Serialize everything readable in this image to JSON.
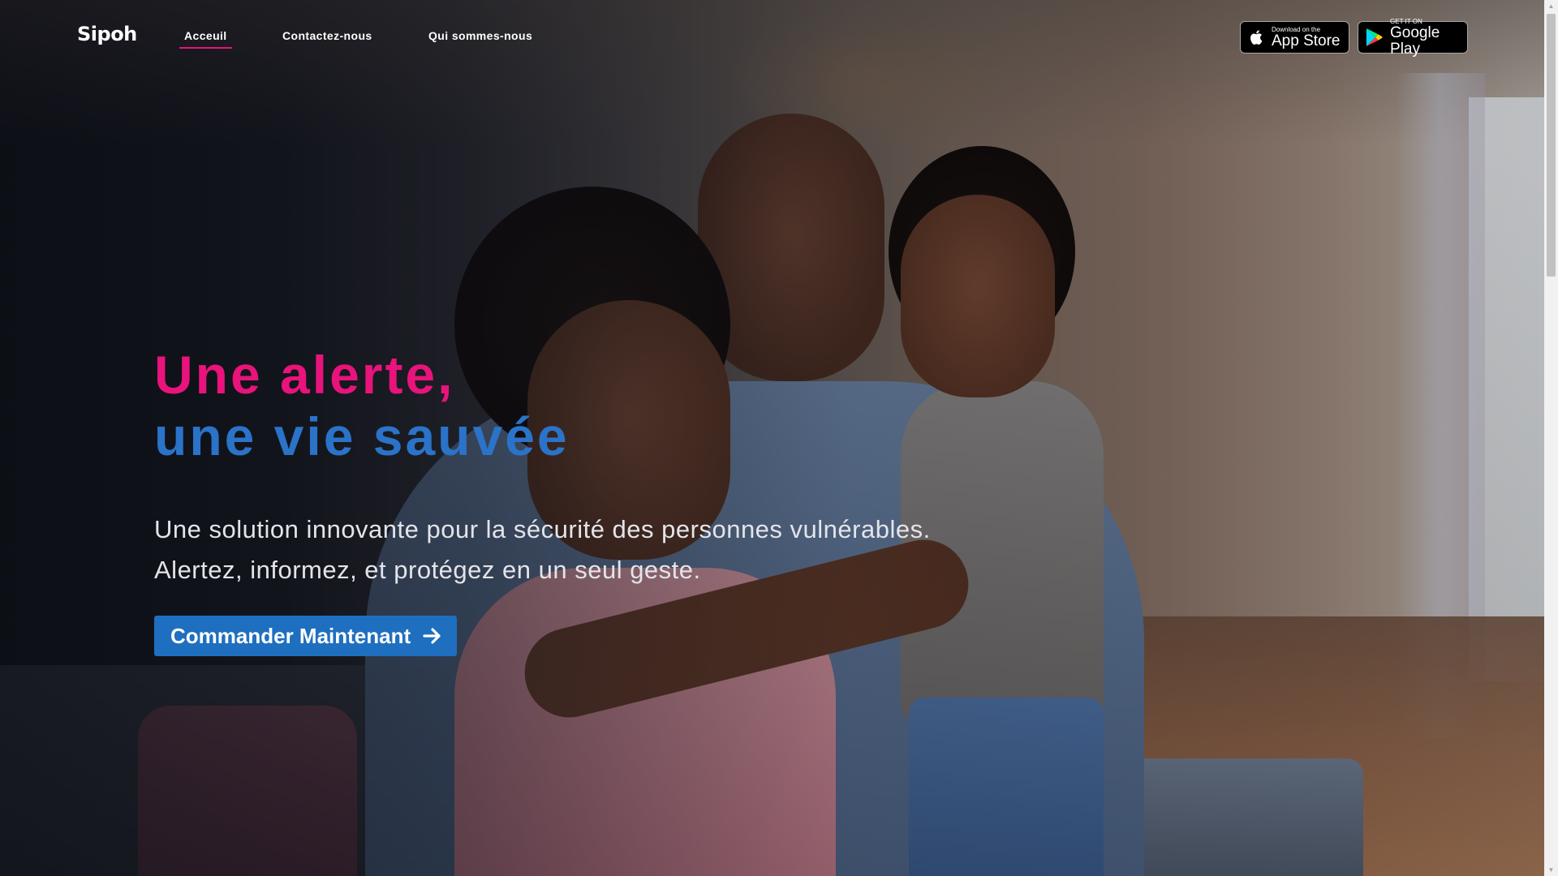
{
  "brand": {
    "logo_text": "Sipoh"
  },
  "nav": {
    "items": [
      {
        "label": "Acceuil",
        "active": true
      },
      {
        "label": "Contactez-nous",
        "active": false
      },
      {
        "label": "Qui sommes-nous",
        "active": false
      }
    ]
  },
  "stores": {
    "app_store": {
      "small": "Download on the",
      "big": "App Store",
      "icon": "apple-icon"
    },
    "google_play": {
      "small": "GET IT ON",
      "big": "Google Play",
      "icon": "google-play-icon"
    }
  },
  "hero": {
    "title_line1": "Une alerte,",
    "title_line2": "une vie sauvée",
    "subtitle_line1": "Une solution innovante pour la sécurité des personnes vulnérables.",
    "subtitle_line2": "Alertez, informez, et protégez en un seul geste.",
    "cta_label": "Commander Maintenant",
    "cta_icon": "arrow-right-icon"
  },
  "colors": {
    "accent_pink": "#e8137b",
    "accent_blue": "#2a73c8",
    "cta_blue": "#1f6fc0"
  }
}
